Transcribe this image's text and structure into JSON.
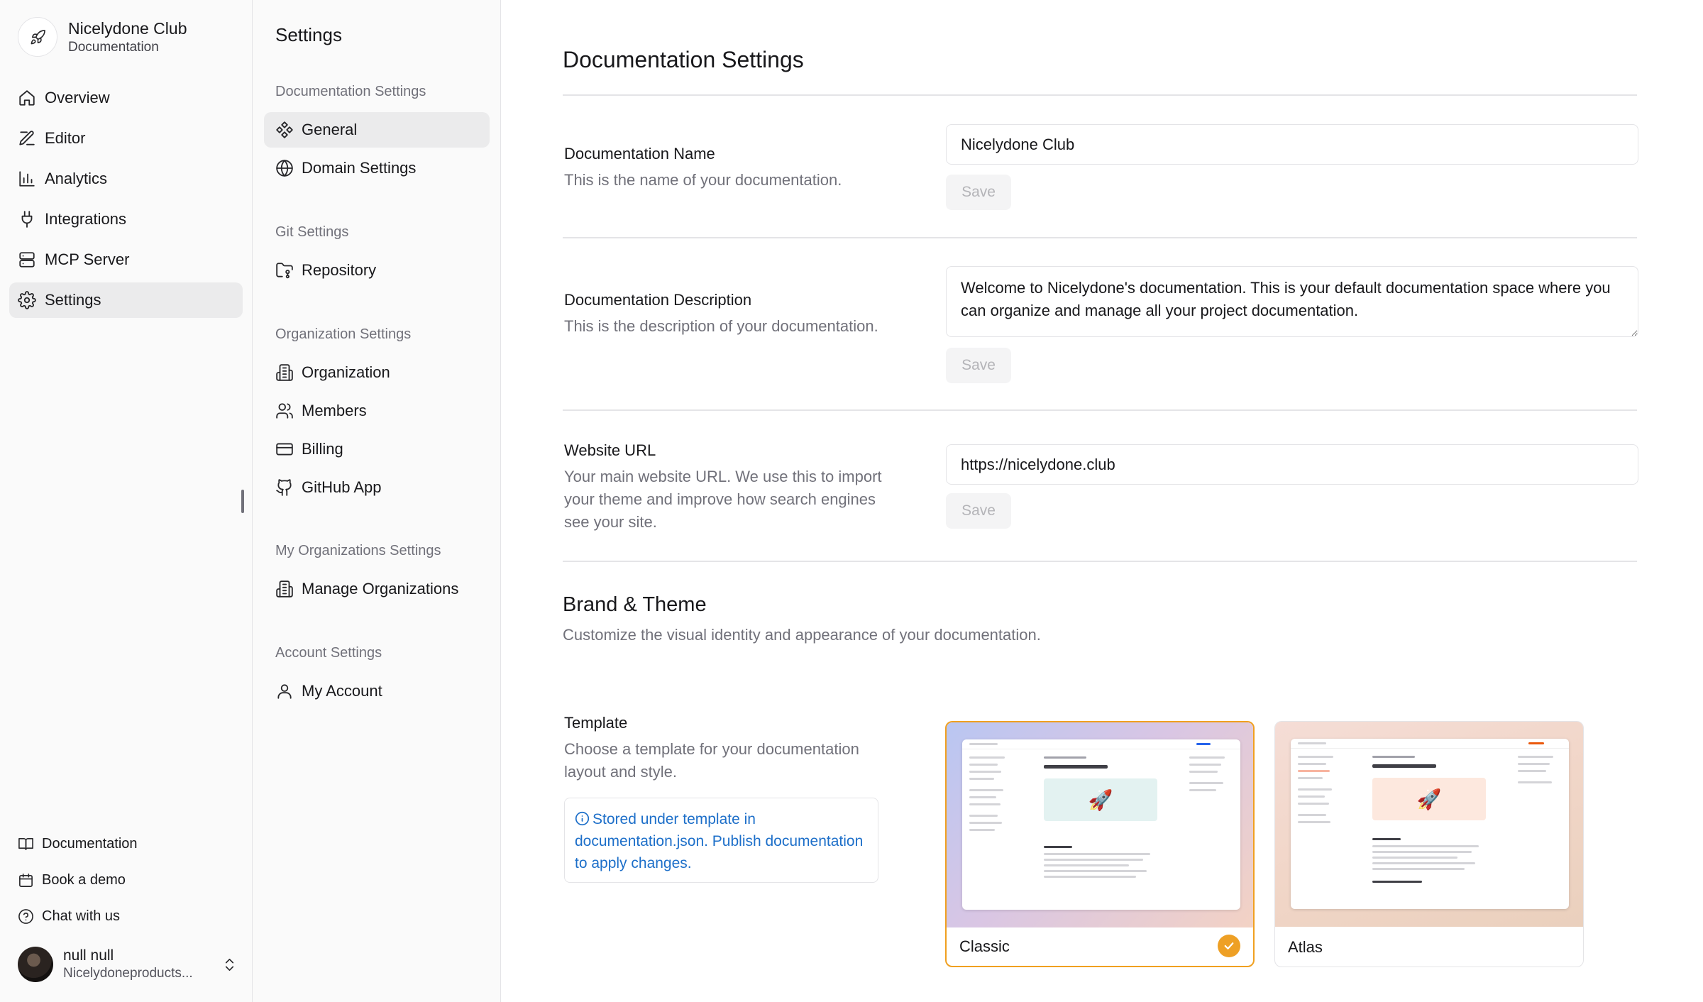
{
  "brand": {
    "name": "Nicelydone Club",
    "subtitle": "Documentation",
    "icon": "rocket-icon"
  },
  "nav": {
    "items": [
      {
        "label": "Overview",
        "icon": "home-icon",
        "active": false
      },
      {
        "label": "Editor",
        "icon": "edit-icon",
        "active": false
      },
      {
        "label": "Analytics",
        "icon": "bar-chart-icon",
        "active": false
      },
      {
        "label": "Integrations",
        "icon": "plug-icon",
        "active": false
      },
      {
        "label": "MCP Server",
        "icon": "server-icon",
        "active": false
      },
      {
        "label": "Settings",
        "icon": "gear-icon",
        "active": true
      }
    ]
  },
  "footer": {
    "links": [
      {
        "label": "Documentation",
        "icon": "book-icon"
      },
      {
        "label": "Book a demo",
        "icon": "calendar-icon"
      },
      {
        "label": "Chat with us",
        "icon": "help-circle-icon"
      }
    ]
  },
  "user": {
    "name": "null null",
    "subtitle": "Nicelydoneproducts..."
  },
  "settings_nav": {
    "title": "Settings",
    "groups": [
      {
        "heading": "Documentation Settings",
        "items": [
          {
            "label": "General",
            "icon": "component-icon",
            "active": true
          },
          {
            "label": "Domain Settings",
            "icon": "globe-icon",
            "active": false
          }
        ]
      },
      {
        "heading": "Git Settings",
        "items": [
          {
            "label": "Repository",
            "icon": "folder-git-icon",
            "active": false
          }
        ]
      },
      {
        "heading": "Organization Settings",
        "items": [
          {
            "label": "Organization",
            "icon": "building-icon",
            "active": false
          },
          {
            "label": "Members",
            "icon": "users-icon",
            "active": false
          },
          {
            "label": "Billing",
            "icon": "credit-card-icon",
            "active": false
          },
          {
            "label": "GitHub App",
            "icon": "github-icon",
            "active": false
          }
        ]
      },
      {
        "heading": "My Organizations Settings",
        "items": [
          {
            "label": "Manage Organizations",
            "icon": "building-icon",
            "active": false
          }
        ]
      },
      {
        "heading": "Account Settings",
        "items": [
          {
            "label": "My Account",
            "icon": "user-icon",
            "active": false
          }
        ]
      }
    ]
  },
  "main": {
    "title": "Documentation Settings",
    "fields": {
      "name": {
        "label": "Documentation Name",
        "description": "This is the name of your documentation.",
        "value": "Nicelydone Club",
        "save_label": "Save"
      },
      "description": {
        "label": "Documentation Description",
        "description": "This is the description of your documentation.",
        "value": "Welcome to Nicelydone's documentation. This is your default documentation space where you can organize and manage all your project documentation.",
        "save_label": "Save"
      },
      "website": {
        "label": "Website URL",
        "description": "Your main website URL. We use this to import your theme and improve how search engines see your site.",
        "value": "https://nicelydone.club",
        "save_label": "Save"
      }
    },
    "brand_theme": {
      "title": "Brand & Theme",
      "description": "Customize the visual identity and appearance of your documentation.",
      "template": {
        "label": "Template",
        "description": "Choose a template for your documentation layout and style.",
        "notice": "Stored under template in documentation.json. Publish documentation to apply changes.",
        "options": [
          {
            "name": "Classic",
            "selected": true
          },
          {
            "name": "Atlas",
            "selected": false
          }
        ]
      }
    }
  },
  "colors": {
    "accent": "#eea025",
    "notice": "#1d6fc9",
    "active_bg": "#ebebec"
  }
}
